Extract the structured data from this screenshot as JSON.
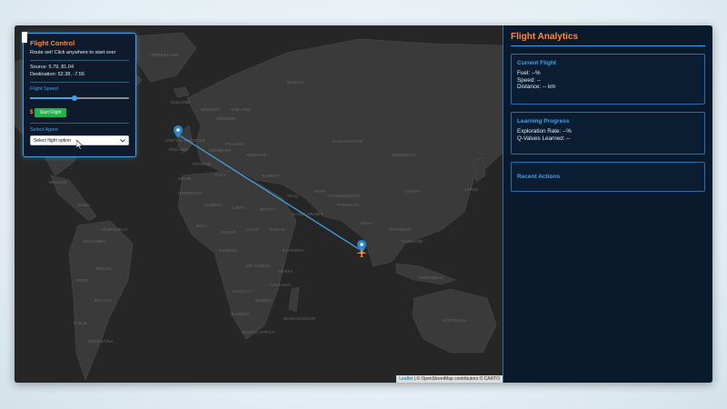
{
  "control": {
    "title": "Flight Control",
    "instruction": "Route set! Click anywhere to start over",
    "source": "Source: 5.79, 81.04",
    "destination": "Destination: 52.38, -7.56",
    "speed_label": "Flight Speed",
    "speed_level_percent": 45,
    "currency_symbol": "$",
    "start_label": "Start Flight",
    "agent_label": "Select Agent",
    "agent_selected": "Select flight option"
  },
  "analytics": {
    "title": "Flight Analytics",
    "current_flight": {
      "title": "Current Flight",
      "fuel": "Fuel: --%",
      "speed": "Speed: --",
      "distance": "Distance: -- km"
    },
    "learning": {
      "title": "Learning Progress",
      "exploration": "Exploration Rate: --%",
      "qvalues": "Q-Values Learned: --"
    },
    "recent": {
      "title": "Recent Actions"
    }
  },
  "map": {
    "attribution_leaflet": "Leaflet",
    "attribution_rest": "| © OpenStreetMap contributors © CARTO",
    "route_color": "#3ea3e8",
    "marker_color": "#2e86c9",
    "plane_color": "#ff8a3d",
    "labels": [
      "RUSSIA",
      "CANADA",
      "UNITED STATES",
      "MEXICO",
      "GREENLAND",
      "ICELAND",
      "NORWAY",
      "SWEDEN",
      "FINLAND",
      "UNITED KINGDOM",
      "IRELAND",
      "POLAND",
      "GERMANY",
      "FRANCE",
      "SPAIN",
      "ITALY",
      "UKRAINE",
      "TURKEY",
      "IRAN",
      "IRAQ",
      "SAUDI ARABIA",
      "EGYPT",
      "LIBYA",
      "ALGERIA",
      "MOROCCO",
      "MALI",
      "NIGER",
      "CHAD",
      "SUDAN",
      "ETHIOPIA",
      "NIGERIA",
      "DR CONGO",
      "KENYA",
      "TANZANIA",
      "ANGOLA",
      "ZAMBIA",
      "NAMIBIA",
      "SOUTH AFRICA",
      "MADAGASCAR",
      "KAZAKHSTAN",
      "MONGOLIA",
      "CHINA",
      "INDIA",
      "PAKISTAN",
      "AFGHANISTAN",
      "MYANMAR",
      "THAILAND",
      "JAPAN",
      "INDONESIA",
      "AUSTRALIA",
      "BRAZIL",
      "PERU",
      "COLOMBIA",
      "VENEZUELA",
      "BOLIVIA",
      "ARGENTINA",
      "CHILE",
      "CUBA"
    ]
  }
}
